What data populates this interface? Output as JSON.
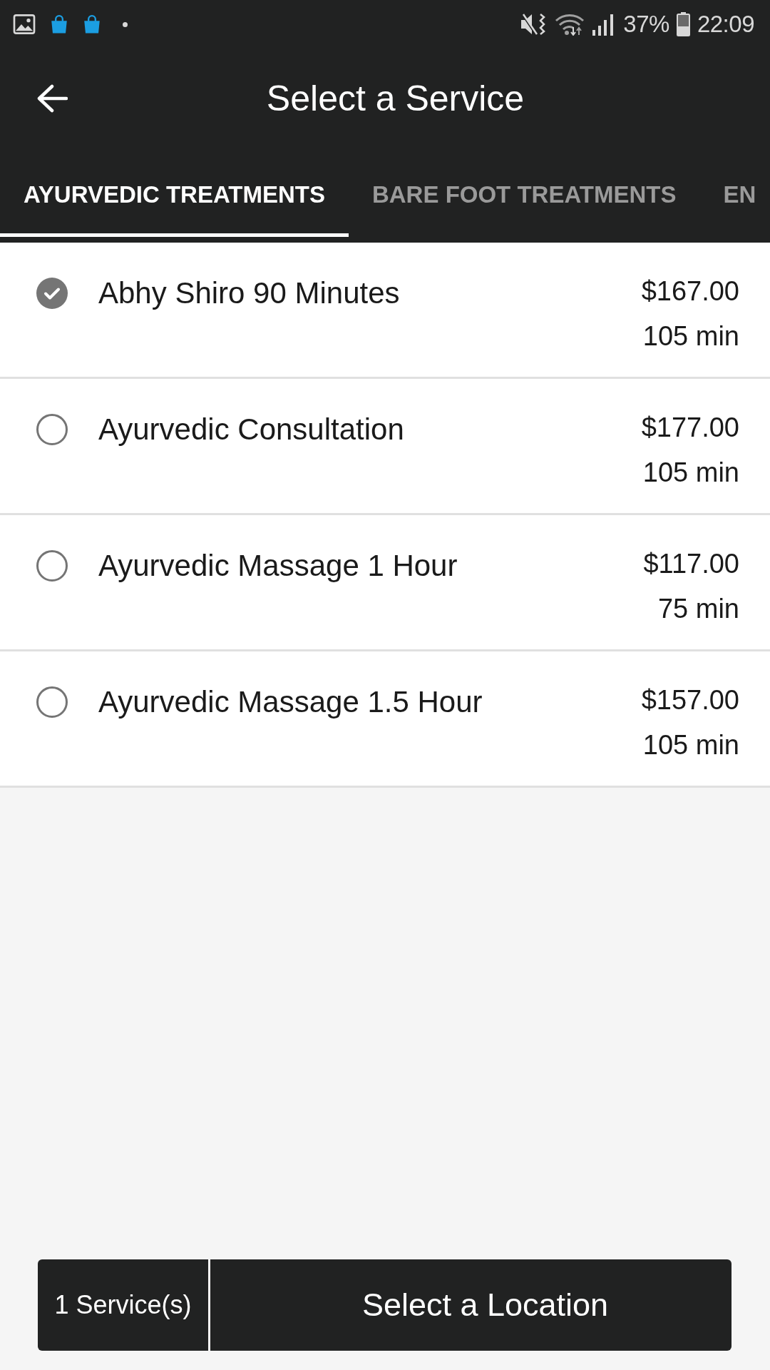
{
  "status_bar": {
    "battery": "37%",
    "time": "22:09"
  },
  "app_bar": {
    "title": "Select a Service"
  },
  "tabs": [
    {
      "label": "AYURVEDIC TREATMENTS",
      "selected": true
    },
    {
      "label": "BARE FOOT TREATMENTS",
      "selected": false
    },
    {
      "label": "EN",
      "selected": false
    }
  ],
  "services": [
    {
      "name": "Abhy Shiro 90 Minutes",
      "price": "$167.00",
      "duration": "105 min",
      "selected": true
    },
    {
      "name": "Ayurvedic Consultation",
      "price": "$177.00",
      "duration": "105 min",
      "selected": false
    },
    {
      "name": "Ayurvedic Massage 1 Hour",
      "price": "$117.00",
      "duration": "75 min",
      "selected": false
    },
    {
      "name": "Ayurvedic Massage 1.5 Hour",
      "price": "$157.00",
      "duration": "105 min",
      "selected": false
    }
  ],
  "footer": {
    "count": "1 Service(s)",
    "action": "Select a Location"
  }
}
